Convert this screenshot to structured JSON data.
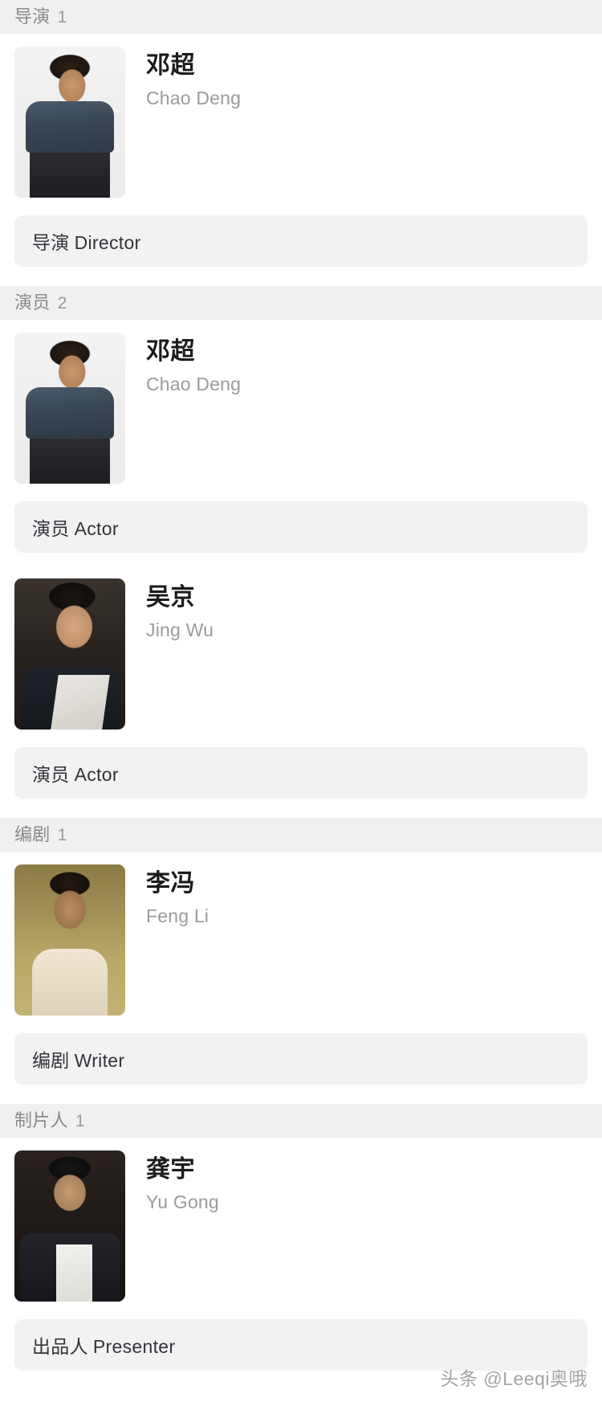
{
  "watermark": "头条 @Leeqi奥哦",
  "sections": [
    {
      "label": "导演",
      "count": "1",
      "people": [
        {
          "name_cn": "邓超",
          "name_en": "Chao Deng",
          "role_cn": "导演",
          "role_en": "Director",
          "avatar": "portrait-chao-deng"
        }
      ]
    },
    {
      "label": "演员",
      "count": "2",
      "people": [
        {
          "name_cn": "邓超",
          "name_en": "Chao Deng",
          "role_cn": "演员",
          "role_en": "Actor",
          "avatar": "portrait-chao-deng"
        },
        {
          "name_cn": "吴京",
          "name_en": "Jing Wu",
          "role_cn": "演员",
          "role_en": "Actor",
          "avatar": "portrait-jing-wu"
        }
      ]
    },
    {
      "label": "编剧",
      "count": "1",
      "people": [
        {
          "name_cn": "李冯",
          "name_en": "Feng Li",
          "role_cn": "编剧",
          "role_en": "Writer",
          "avatar": "portrait-feng-li"
        }
      ]
    },
    {
      "label": "制片人",
      "count": "1",
      "people": [
        {
          "name_cn": "龚宇",
          "name_en": "Yu Gong",
          "role_cn": "出品人",
          "role_en": "Presenter",
          "avatar": "portrait-yu-gong"
        }
      ]
    }
  ]
}
